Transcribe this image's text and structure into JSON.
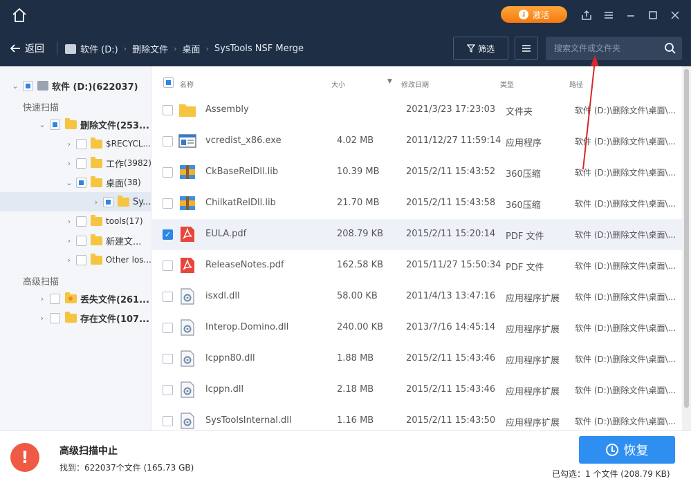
{
  "titlebar": {
    "activate_label": "激活",
    "activate_icon": "key-icon"
  },
  "nav": {
    "back_label": "返回",
    "breadcrumb": [
      "软件 (D:)",
      "删除文件",
      "桌面",
      "SysTools NSF Merge"
    ],
    "filter_label": "筛选",
    "search_placeholder": "搜索文件或文件夹"
  },
  "sidebar": {
    "root_label": "软件 (D:)(622037)",
    "quick_scan_label": "快速扫描",
    "deleted_label": "删除文件(253...",
    "recycle_label": "$RECYCL...",
    "work_label": "工作",
    "work_count": "(3982)",
    "desktop_label": "桌面",
    "desktop_count": "(38)",
    "sy_label": "Sy...",
    "tools_label": "tools",
    "tools_count": "(17)",
    "newfolder_label": "新建文...",
    "otherlost_label": "Other los...",
    "advanced_scan_label": "高级扫描",
    "lost_label": "丢失文件(261...",
    "existing_label": "存在文件(107..."
  },
  "columns": {
    "name": "名称",
    "size": "大小",
    "date": "修改日期",
    "type": "类型",
    "path": "路径"
  },
  "files": [
    {
      "name": "Assembly",
      "size": "",
      "date": "2021/3/23 17:23:03",
      "type": "文件夹",
      "path": "软件 (D:)\\删除文件\\桌面\\...",
      "icon": "folder-icon",
      "checked": false
    },
    {
      "name": "vcredist_x86.exe",
      "size": "4.02 MB",
      "date": "2011/12/27 11:59:14",
      "type": "应用程序",
      "path": "软件 (D:)\\删除文件\\桌面\\...",
      "icon": "exe-icon",
      "checked": false
    },
    {
      "name": "CkBaseRelDll.lib",
      "size": "10.39 MB",
      "date": "2015/2/11 15:43:52",
      "type": "360压缩",
      "path": "软件 (D:)\\删除文件\\桌面\\...",
      "icon": "archive-icon",
      "checked": false
    },
    {
      "name": "ChilkatRelDll.lib",
      "size": "21.70 MB",
      "date": "2015/2/11 15:43:58",
      "type": "360压缩",
      "path": "软件 (D:)\\删除文件\\桌面\\...",
      "icon": "archive-icon",
      "checked": false
    },
    {
      "name": "EULA.pdf",
      "size": "208.79 KB",
      "date": "2015/2/11 15:20:14",
      "type": "PDF 文件",
      "path": "软件 (D:)\\删除文件\\桌面\\...",
      "icon": "pdf-icon",
      "checked": true
    },
    {
      "name": "ReleaseNotes.pdf",
      "size": "162.58 KB",
      "date": "2015/11/27 15:50:34",
      "type": "PDF 文件",
      "path": "软件 (D:)\\删除文件\\桌面\\...",
      "icon": "pdf-icon",
      "checked": false
    },
    {
      "name": "isxdl.dll",
      "size": "58.00 KB",
      "date": "2011/4/13 13:47:16",
      "type": "应用程序扩展",
      "path": "软件 (D:)\\删除文件\\桌面\\...",
      "icon": "dll-icon",
      "checked": false
    },
    {
      "name": "Interop.Domino.dll",
      "size": "240.00 KB",
      "date": "2013/7/16 14:45:14",
      "type": "应用程序扩展",
      "path": "软件 (D:)\\删除文件\\桌面\\...",
      "icon": "dll-icon",
      "checked": false
    },
    {
      "name": "lcppn80.dll",
      "size": "1.88 MB",
      "date": "2015/2/11 15:43:46",
      "type": "应用程序扩展",
      "path": "软件 (D:)\\删除文件\\桌面\\...",
      "icon": "dll-icon",
      "checked": false
    },
    {
      "name": "lcppn.dll",
      "size": "2.18 MB",
      "date": "2015/2/11 15:43:46",
      "type": "应用程序扩展",
      "path": "软件 (D:)\\删除文件\\桌面\\...",
      "icon": "dll-icon",
      "checked": false
    },
    {
      "name": "SysToolsInternal.dll",
      "size": "1.16 MB",
      "date": "2015/2/11 15:43:50",
      "type": "应用程序扩展",
      "path": "软件 (D:)\\删除文件\\桌面\\...",
      "icon": "dll-icon",
      "checked": false
    }
  ],
  "footer": {
    "status_title": "高级扫描中止",
    "found_text": "找到：622037个文件 (165.73 GB)",
    "recover_label": "恢复",
    "selected_text": "已勾选：1 个文件 (208.79 KB)"
  },
  "colors": {
    "titlebar": "#1e2e45",
    "accent": "#2f8ff0",
    "activate": "#f47a10",
    "alert": "#ef5a44"
  }
}
